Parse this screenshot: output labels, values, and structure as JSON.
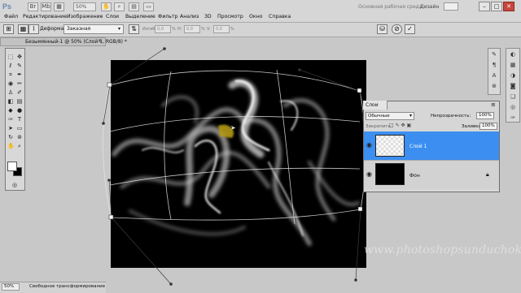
{
  "app": {
    "logo": "Ps",
    "zoom": "50%",
    "workspace": "Основная рабочая среда",
    "design": "Дизайн"
  },
  "menu": [
    "Файл",
    "Редактирование",
    "Изображение",
    "Слои",
    "Выделение",
    "Фильтр",
    "Анализ",
    "3D",
    "Просмотр",
    "Окно",
    "Справка"
  ],
  "window_controls": {
    "minimize": "–",
    "maximize": "□",
    "close": "✕"
  },
  "options": {
    "label": "Деформация:",
    "warp": "Заказная",
    "fields": [
      {
        "label": "Изгиб:",
        "value": "0,0"
      },
      {
        "label": "H:",
        "value": "0,0"
      },
      {
        "label": "V:",
        "value": "0,0"
      }
    ],
    "units": [
      "%",
      "%",
      "%"
    ]
  },
  "doc_tab": {
    "title": "Безымянный-1 @ 50% (Слой 1, RGB/8) *",
    "close": "×"
  },
  "layers_panel": {
    "tab": "Слои",
    "blend_mode": "Обычные",
    "opacity_label": "Непрозрачность:",
    "opacity": "100%",
    "lock_label": "Закрепить:",
    "fill_label": "Заливка:",
    "fill": "100%",
    "layers": [
      {
        "name": "Слой 1",
        "selected": true
      },
      {
        "name": "Фон",
        "selected": false
      }
    ]
  },
  "status": {
    "zoom": "50%",
    "text": "Свободное трансформирование"
  },
  "watermark": "www.photoshopsunduchok.ru",
  "colors": {
    "selection": "#3c8ef0",
    "canvas": "#000000",
    "workspace": "#c8c8c8"
  },
  "icons": [
    "move-icon",
    "marquee-icon",
    "lasso-icon",
    "crop-icon",
    "brush-icon",
    "eye-icon",
    "lock-icon",
    "commit-icon",
    "cancel-icon"
  ]
}
